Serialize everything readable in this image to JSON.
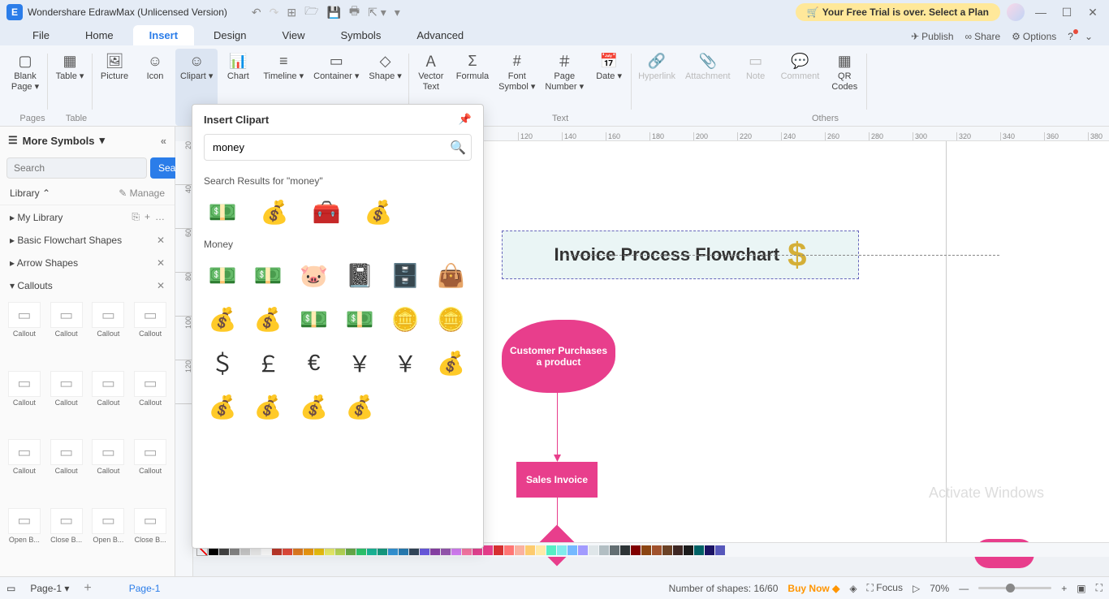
{
  "app": {
    "title": "Wondershare EdrawMax (Unlicensed Version)",
    "trial_banner": "Your Free Trial is over. Select a Plan"
  },
  "menubar": {
    "items": [
      "File",
      "Home",
      "Insert",
      "Design",
      "View",
      "Symbols",
      "Advanced"
    ],
    "active": "Insert",
    "right": {
      "publish": "Publish",
      "share": "Share",
      "options": "Options"
    }
  },
  "ribbon": {
    "items": [
      {
        "label": "Blank\nPage",
        "dd": true
      },
      {
        "label": "Table",
        "dd": true
      },
      {
        "label": "Picture"
      },
      {
        "label": "Icon"
      },
      {
        "label": "Clipart",
        "active": true,
        "dd": true
      },
      {
        "label": "Chart"
      },
      {
        "label": "Timeline",
        "dd": true
      },
      {
        "label": "Container",
        "dd": true
      },
      {
        "label": "Shape",
        "dd": true
      },
      {
        "label": "Vector\nText"
      },
      {
        "label": "Formula"
      },
      {
        "label": "Font\nSymbol",
        "dd": true
      },
      {
        "label": "Page\nNumber",
        "dd": true
      },
      {
        "label": "Date",
        "dd": true
      },
      {
        "label": "Hyperlink",
        "disabled": true
      },
      {
        "label": "Attachment",
        "disabled": true
      },
      {
        "label": "Note",
        "disabled": true
      },
      {
        "label": "Comment",
        "disabled": true
      },
      {
        "label": "QR\nCodes"
      }
    ],
    "groups": [
      "Pages",
      "Table",
      "",
      "",
      "",
      "",
      "",
      "",
      "",
      "Text",
      "",
      "",
      "",
      "",
      "Others",
      "",
      "",
      "",
      ""
    ]
  },
  "left_panel": {
    "header": "More Symbols",
    "search_placeholder": "Search",
    "search_btn": "Search",
    "library": "Library",
    "manage": "Manage",
    "sections": [
      {
        "label": "My Library",
        "icons": [
          "⎘",
          "+",
          "…"
        ]
      },
      {
        "label": "Basic Flowchart Shapes",
        "icons": [
          "✕"
        ]
      },
      {
        "label": "Arrow Shapes",
        "icons": [
          "✕"
        ]
      },
      {
        "label": "Callouts",
        "icons": [
          "✕"
        ],
        "open": true
      }
    ],
    "callouts": [
      "Callout",
      "Callout",
      "Callout",
      "Callout",
      "Callout",
      "Callout",
      "Callout",
      "Callout",
      "Callout",
      "Callout",
      "Callout",
      "Callout",
      "Open B...",
      "Close B...",
      "Open B...",
      "Close B..."
    ]
  },
  "clipart": {
    "title": "Insert Clipart",
    "search_value": "money",
    "results_title": "Search Results for  \"money\"",
    "results": [
      "💵",
      "💰",
      "🧰",
      "💰"
    ],
    "cat_title": "Money",
    "cat_items": [
      "💵",
      "💵",
      "🐷",
      "📓",
      "🗄️",
      "👜",
      "💰",
      "💰",
      "💵",
      "💵",
      "🪙",
      "🪙",
      "＄",
      "￡",
      "€",
      "￥",
      "￥",
      "💰",
      "💰",
      "💰",
      "💰",
      "💰"
    ]
  },
  "canvas": {
    "title": "Invoice Process Flowchart",
    "node1": "Customer Purchases a product",
    "node2": "Sales Invoice",
    "ruler_h": [
      "120",
      "140",
      "160",
      "180",
      "200",
      "220",
      "240",
      "260",
      "280",
      "300",
      "320",
      "340",
      "360",
      "380"
    ],
    "ruler_v": [
      "20",
      "40",
      "60",
      "80",
      "100",
      "120"
    ]
  },
  "colorbar": [
    "#000",
    "#444",
    "#888",
    "#ccc",
    "#eee",
    "#fff",
    "#c0392b",
    "#e74c3c",
    "#e67e22",
    "#f39c12",
    "#f1c40f",
    "#eef26b",
    "#badc58",
    "#6ab04c",
    "#2ecc71",
    "#1abc9c",
    "#16a085",
    "#3498db",
    "#2980b9",
    "#34495e",
    "#6c5ce7",
    "#8e44ad",
    "#9b59b6",
    "#d980fa",
    "#fd79a8",
    "#e84393",
    "#e83e8c",
    "#d63031",
    "#ff7675",
    "#fab1a0",
    "#fdcb6e",
    "#ffeaa7",
    "#55efc4",
    "#81ecec",
    "#74b9ff",
    "#a29bfe",
    "#dfe6e9",
    "#b2bec3",
    "#636e72",
    "#2d3436",
    "#800000",
    "#8b4513",
    "#a0522d",
    "#6b4226",
    "#3e2723",
    "#1b1b1b",
    "#006266",
    "#1B1464",
    "#5758BB"
  ],
  "status": {
    "page_tab_left": "Page-1",
    "page_tab_canvas": "Page-1",
    "shapes": "Number of shapes: 16/60",
    "buy": "Buy Now",
    "focus": "Focus",
    "zoom": "70%"
  },
  "watermark": "Activate Windows"
}
